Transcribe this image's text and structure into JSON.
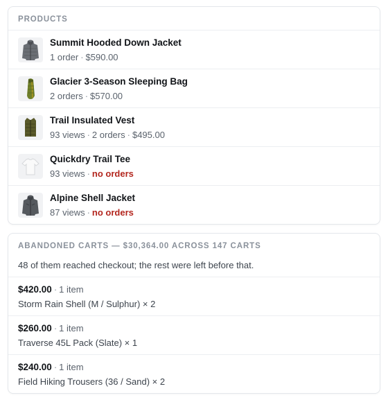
{
  "products": {
    "title": "PRODUCTS",
    "items": [
      {
        "name": "Summit Hooded Down Jacket",
        "stats": [
          "1 order",
          "$590.00"
        ],
        "status": "",
        "icon": "down-jacket-icon"
      },
      {
        "name": "Glacier 3-Season Sleeping Bag",
        "stats": [
          "2 orders",
          "$570.00"
        ],
        "status": "",
        "icon": "sleeping-bag-icon"
      },
      {
        "name": "Trail Insulated Vest",
        "stats": [
          "93 views",
          "2 orders",
          "$495.00"
        ],
        "status": "",
        "icon": "vest-icon"
      },
      {
        "name": "Quickdry Trail Tee",
        "stats": [
          "93 views"
        ],
        "status": "no orders",
        "icon": "tee-icon"
      },
      {
        "name": "Alpine Shell Jacket",
        "stats": [
          "87 views"
        ],
        "status": "no orders",
        "icon": "shell-jacket-icon"
      }
    ]
  },
  "abandoned_carts": {
    "title": "ABANDONED CARTS — $30,364.00 ACROSS 147 CARTS",
    "intro": "48 of them reached checkout; the rest were left before that.",
    "carts": [
      {
        "amount": "$420.00",
        "count": "1 item",
        "line": "Storm Rain Shell (M / Sulphur) × 2"
      },
      {
        "amount": "$260.00",
        "count": "1 item",
        "line": "Traverse 45L Pack (Slate) × 1"
      },
      {
        "amount": "$240.00",
        "count": "1 item",
        "line": "Field Hiking Trousers (36 / Sand) × 2"
      }
    ]
  },
  "colors": {
    "muted": "#8a919b",
    "danger": "#b3261e",
    "border": "#e4e7eb"
  }
}
